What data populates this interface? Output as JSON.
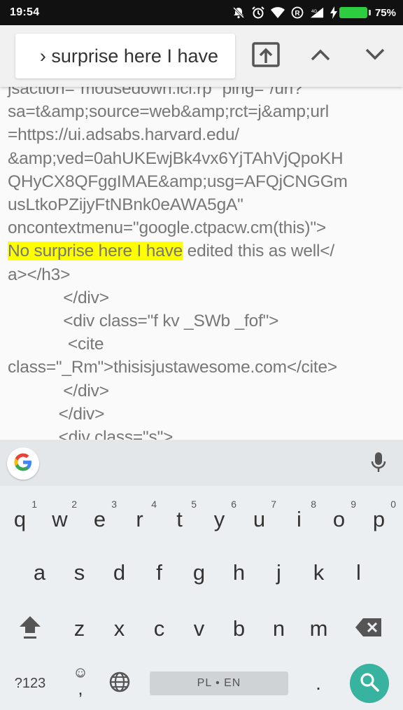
{
  "status_bar": {
    "time": "19:54",
    "battery_percent": "75%",
    "battery_level": 0.75,
    "battery_color": "#2ecc40",
    "icons": [
      "alarm-silent-icon",
      "alarm-clock-icon",
      "wifi-icon",
      "registered-icon",
      "signal-icon",
      "charging-icon",
      "battery-icon"
    ]
  },
  "find_bar": {
    "query_text": "› surprise here I have",
    "buttons": [
      "share-icon",
      "chevron-up-icon",
      "chevron-down-icon"
    ]
  },
  "page": {
    "lines": [
      "jsaction=\"mousedown:lcl.rp\" ping=\"/url?",
      "sa=t&amp;source=web&amp;rct=j&amp;url",
      "=https://ui.adsabs.harvard.edu/",
      "&amp;ved=0ahUKEwjBk4vx6YjTAhVjQpoKH",
      "QHyCX8QFggIMAE&amp;usg=AFQjCNGGm",
      "usLtkoPZijyFtNBnk0eAWA5gA\"",
      "oncontextmenu=\"google.ctpacw.cm(this)\">"
    ],
    "highlight": "No surprise here I have",
    "after_highlight": " edited this as well</",
    "lines_after": [
      "a></h3>",
      "            </div>",
      "            <div class=\"f kv _SWb _fof\">",
      "             <cite",
      "class=\"_Rm\">thisisjustawesome.com</cite>",
      "            </div>",
      "           </div>",
      "           <div class=\"s\">"
    ],
    "highlight_color": "#ffff00"
  },
  "keyboard": {
    "row1": [
      {
        "l": "q",
        "h": "1"
      },
      {
        "l": "w",
        "h": "2"
      },
      {
        "l": "e",
        "h": "3"
      },
      {
        "l": "r",
        "h": "4"
      },
      {
        "l": "t",
        "h": "5"
      },
      {
        "l": "y",
        "h": "6"
      },
      {
        "l": "u",
        "h": "7"
      },
      {
        "l": "i",
        "h": "8"
      },
      {
        "l": "o",
        "h": "9"
      },
      {
        "l": "p",
        "h": "0"
      }
    ],
    "row2": [
      "a",
      "s",
      "d",
      "f",
      "g",
      "h",
      "j",
      "k",
      "l"
    ],
    "row3": [
      "z",
      "x",
      "c",
      "v",
      "b",
      "n",
      "m"
    ],
    "symbols_label": "?123",
    "comma_label": ",",
    "period_label": ".",
    "space_label": "PL • EN",
    "accent_color": "#38b39f"
  }
}
